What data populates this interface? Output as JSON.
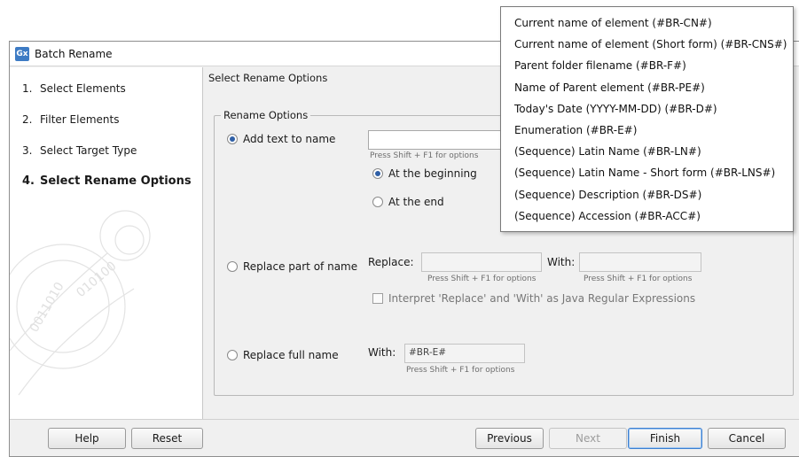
{
  "window": {
    "title": "Batch Rename",
    "app_icon": "Gx"
  },
  "steps": [
    {
      "num": "1.",
      "label": "Select Elements"
    },
    {
      "num": "2.",
      "label": "Filter Elements"
    },
    {
      "num": "3.",
      "label": "Select Target Type"
    },
    {
      "num": "4.",
      "label": "Select Rename Options"
    }
  ],
  "main": {
    "section_title": "Select Rename Options",
    "group_label": "Rename Options",
    "add_text": {
      "label": "Add text to name",
      "value": "",
      "hint": "Press Shift + F1 for options",
      "at_beginning": "At the beginning",
      "at_end": "At the end"
    },
    "replace_part": {
      "label": "Replace part of name",
      "replace_label": "Replace:",
      "with_label": "With:",
      "replace_value": "",
      "with_value": "",
      "replace_hint": "Press Shift + F1 for options",
      "with_hint": "Press Shift + F1 for options",
      "regex_label": "Interpret 'Replace' and 'With' as Java Regular Expressions"
    },
    "replace_full": {
      "label": "Replace full name",
      "with_label": "With:",
      "value": "#BR-E#",
      "hint": "Press Shift + F1 for options"
    }
  },
  "buttons": {
    "help": "Help",
    "reset": "Reset",
    "previous": "Previous",
    "next": "Next",
    "finish": "Finish",
    "cancel": "Cancel"
  },
  "popup_items": [
    "Current name of element (#BR-CN#)",
    "Current name of element (Short form) (#BR-CNS#)",
    "Parent folder filename (#BR-F#)",
    "Name of Parent element (#BR-PE#)",
    "Today's Date (YYYY-MM-DD) (#BR-D#)",
    "Enumeration (#BR-E#)",
    "(Sequence) Latin Name (#BR-LN#)",
    "(Sequence) Latin Name - Short form (#BR-LNS#)",
    "(Sequence) Description (#BR-DS#)",
    "(Sequence) Accession (#BR-ACC#)"
  ]
}
